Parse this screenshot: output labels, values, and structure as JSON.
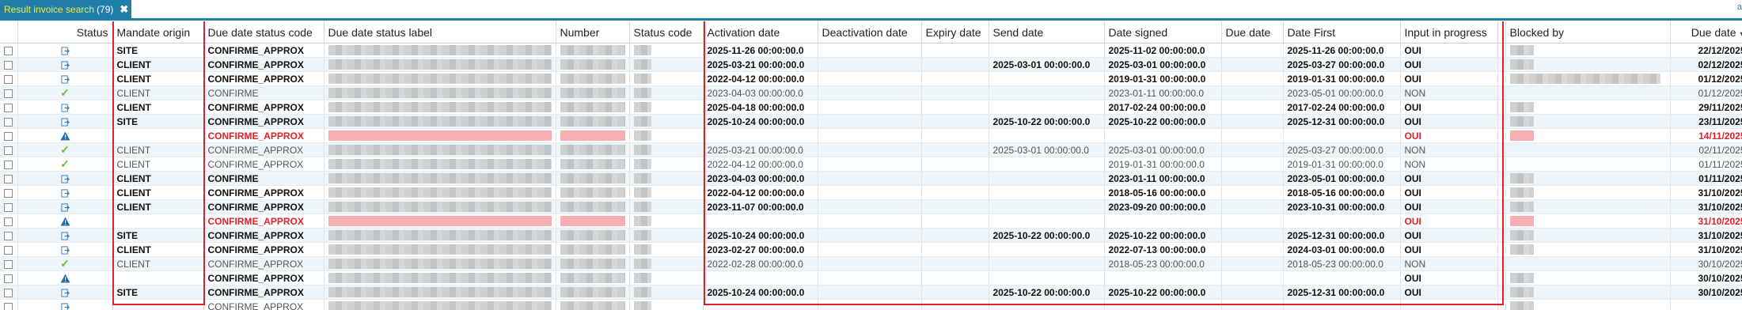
{
  "tab": {
    "title": "Result invoice search",
    "count": "(79)",
    "close": "✖"
  },
  "corner_link": "a",
  "columns": [
    {
      "key": "check",
      "label": ""
    },
    {
      "key": "status",
      "label": "Status"
    },
    {
      "key": "mandate_origin",
      "label": "Mandate origin"
    },
    {
      "key": "due_date_status_code",
      "label": "Due date status code"
    },
    {
      "key": "due_date_status_label",
      "label": "Due date status label"
    },
    {
      "key": "number",
      "label": "Number"
    },
    {
      "key": "status_code",
      "label": "Status code"
    },
    {
      "key": "activation_date",
      "label": "Activation date"
    },
    {
      "key": "deactivation_date",
      "label": "Deactivation date"
    },
    {
      "key": "expiry_date",
      "label": "Expiry date"
    },
    {
      "key": "send_date",
      "label": "Send date"
    },
    {
      "key": "date_signed",
      "label": "Date signed"
    },
    {
      "key": "due_date_short",
      "label": "Due date"
    },
    {
      "key": "date_first",
      "label": "Date First"
    },
    {
      "key": "input_in_progress",
      "label": "Input in progress"
    },
    {
      "key": "gap",
      "label": ""
    },
    {
      "key": "blocked_by",
      "label": "Blocked by"
    },
    {
      "key": "due_date",
      "label": "Due date"
    }
  ],
  "sort_indicator": "▼",
  "rows": [
    {
      "style": "bold",
      "icon": "export",
      "origin": "SITE",
      "code": "CONFIRME_APPROX",
      "activation": "2025-11-26 00:00:00.0",
      "send": "",
      "signed": "2025-11-02 00:00:00.0",
      "first": "2025-11-26 00:00:00.0",
      "input": "OUI",
      "due": "22/12/2025",
      "blocked": true
    },
    {
      "style": "bold",
      "icon": "export",
      "origin": "CLIENT",
      "code": "CONFIRME_APPROX",
      "activation": "2025-03-21 00:00:00.0",
      "send": "2025-03-01 00:00:00.0",
      "signed": "2025-03-01 00:00:00.0",
      "first": "2025-03-27 00:00:00.0",
      "input": "OUI",
      "due": "02/12/2025",
      "blocked": true
    },
    {
      "style": "bold",
      "icon": "export",
      "origin": "CLIENT",
      "code": "CONFIRME_APPROX",
      "activation": "2022-04-12 00:00:00.0",
      "send": "",
      "signed": "2019-01-31 00:00:00.0",
      "first": "2019-01-31 00:00:00.0",
      "input": "OUI",
      "due": "01/12/2025",
      "blocked": true
    },
    {
      "style": "normal",
      "icon": "check",
      "origin": "CLIENT",
      "code": "CONFIRME",
      "activation": "2023-04-03 00:00:00.0",
      "send": "",
      "signed": "2023-01-11 00:00:00.0",
      "first": "2023-05-01 00:00:00.0",
      "input": "NON",
      "due": "01/12/2025",
      "blocked": false
    },
    {
      "style": "bold",
      "icon": "export",
      "origin": "CLIENT",
      "code": "CONFIRME_APPROX",
      "activation": "2025-04-18 00:00:00.0",
      "send": "",
      "signed": "2017-02-24 00:00:00.0",
      "first": "2017-02-24 00:00:00.0",
      "input": "OUI",
      "due": "29/11/2025",
      "blocked": true
    },
    {
      "style": "bold",
      "icon": "export",
      "origin": "SITE",
      "code": "CONFIRME_APPROX",
      "activation": "2025-10-24 00:00:00.0",
      "send": "2025-10-22 00:00:00.0",
      "signed": "2025-10-22 00:00:00.0",
      "first": "2025-12-31 00:00:00.0",
      "input": "OUI",
      "due": "23/11/2025",
      "blocked": true
    },
    {
      "style": "red",
      "icon": "warn",
      "origin": "",
      "code": "CONFIRME_APPROX",
      "activation": "",
      "send": "",
      "signed": "",
      "first": "",
      "input": "OUI",
      "due": "14/11/2025",
      "blocked": true
    },
    {
      "style": "normal",
      "icon": "check",
      "origin": "CLIENT",
      "code": "CONFIRME_APPROX",
      "activation": "2025-03-21 00:00:00.0",
      "send": "2025-03-01 00:00:00.0",
      "signed": "2025-03-01 00:00:00.0",
      "first": "2025-03-27 00:00:00.0",
      "input": "NON",
      "due": "02/11/2025",
      "blocked": false
    },
    {
      "style": "normal",
      "icon": "check",
      "origin": "CLIENT",
      "code": "CONFIRME_APPROX",
      "activation": "2022-04-12 00:00:00.0",
      "send": "",
      "signed": "2019-01-31 00:00:00.0",
      "first": "2019-01-31 00:00:00.0",
      "input": "NON",
      "due": "01/11/2025",
      "blocked": false
    },
    {
      "style": "bold",
      "icon": "export",
      "origin": "CLIENT",
      "code": "CONFIRME",
      "activation": "2023-04-03 00:00:00.0",
      "send": "",
      "signed": "2023-01-11 00:00:00.0",
      "first": "2023-05-01 00:00:00.0",
      "input": "OUI",
      "due": "01/11/2025",
      "blocked": true
    },
    {
      "style": "bold",
      "icon": "export",
      "origin": "CLIENT",
      "code": "CONFIRME_APPROX",
      "activation": "2022-04-12 00:00:00.0",
      "send": "",
      "signed": "2018-05-16 00:00:00.0",
      "first": "2018-05-16 00:00:00.0",
      "input": "OUI",
      "due": "31/10/2025",
      "blocked": true
    },
    {
      "style": "bold",
      "icon": "export",
      "origin": "CLIENT",
      "code": "CONFIRME_APPROX",
      "activation": "2023-11-07 00:00:00.0",
      "send": "",
      "signed": "2023-09-20 00:00:00.0",
      "first": "2023-10-31 00:00:00.0",
      "input": "OUI",
      "due": "31/10/2025",
      "blocked": true
    },
    {
      "style": "red",
      "icon": "warn",
      "origin": "",
      "code": "CONFIRME_APPROX",
      "activation": "",
      "send": "",
      "signed": "",
      "first": "",
      "input": "OUI",
      "due": "31/10/2025",
      "blocked": true
    },
    {
      "style": "bold",
      "icon": "export",
      "origin": "SITE",
      "code": "CONFIRME_APPROX",
      "activation": "2025-10-24 00:00:00.0",
      "send": "2025-10-22 00:00:00.0",
      "signed": "2025-10-22 00:00:00.0",
      "first": "2025-12-31 00:00:00.0",
      "input": "OUI",
      "due": "31/10/2025",
      "blocked": true
    },
    {
      "style": "bold",
      "icon": "export",
      "origin": "CLIENT",
      "code": "CONFIRME_APPROX",
      "activation": "2023-02-27 00:00:00.0",
      "send": "",
      "signed": "2022-07-13 00:00:00.0",
      "first": "2024-03-01 00:00:00.0",
      "input": "OUI",
      "due": "31/10/2025",
      "blocked": true
    },
    {
      "style": "normal",
      "icon": "check",
      "origin": "CLIENT",
      "code": "CONFIRME_APPROX",
      "activation": "2022-02-28 00:00:00.0",
      "send": "",
      "signed": "2018-05-23 00:00:00.0",
      "first": "2018-05-23 00:00:00.0",
      "input": "NON",
      "due": "30/10/2025",
      "blocked": false
    },
    {
      "style": "bold",
      "icon": "warn",
      "origin": "",
      "code": "CONFIRME_APPROX",
      "activation": "",
      "send": "",
      "signed": "",
      "first": "",
      "input": "OUI",
      "due": "30/10/2025",
      "blocked": true
    },
    {
      "style": "bold",
      "icon": "export",
      "origin": "SITE",
      "code": "CONFIRME_APPROX",
      "activation": "2025-10-24 00:00:00.0",
      "send": "2025-10-22 00:00:00.0",
      "signed": "2025-10-22 00:00:00.0",
      "first": "2025-12-31 00:00:00.0",
      "input": "OUI",
      "due": "30/10/2025",
      "blocked": true
    },
    {
      "style": "normal",
      "icon": "export",
      "origin": "",
      "code": "CONFIRME_APPROX",
      "activation": "",
      "send": "",
      "signed": "",
      "first": "",
      "input": "",
      "due": "",
      "blocked": true
    }
  ]
}
